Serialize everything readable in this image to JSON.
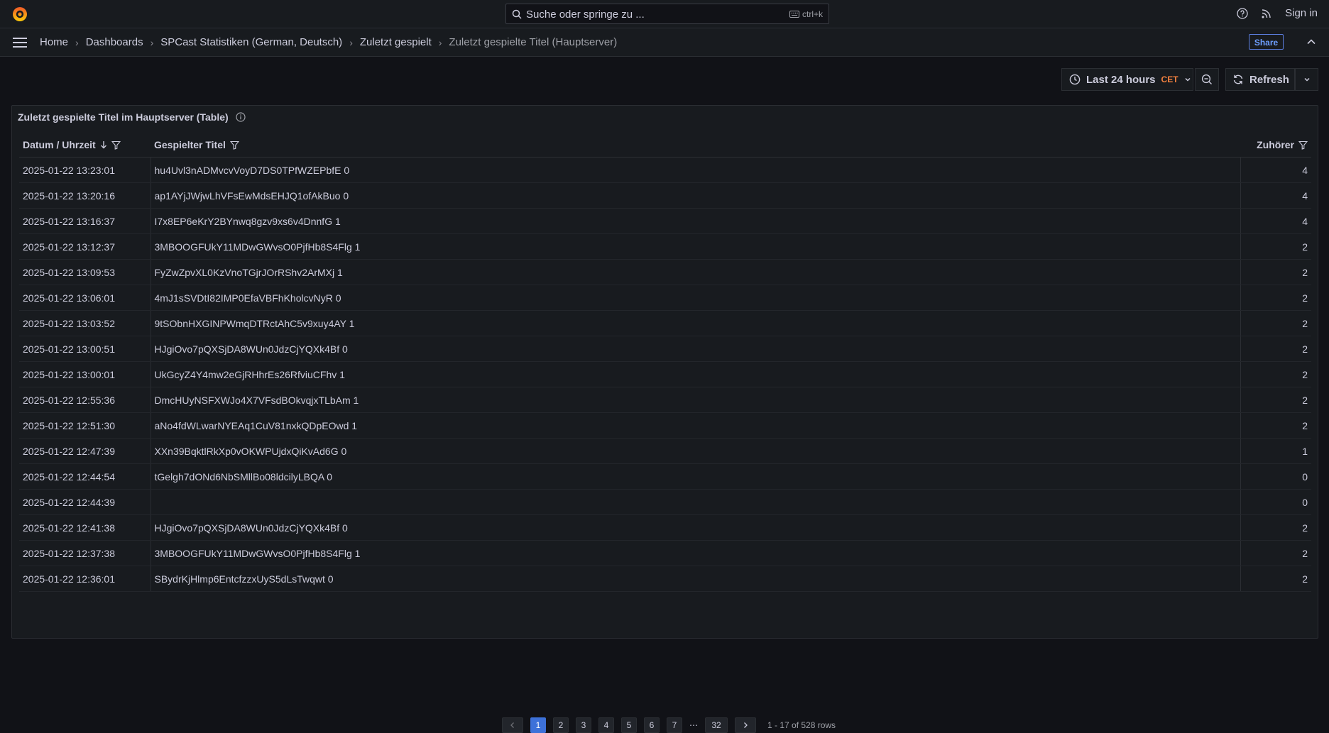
{
  "topbar": {
    "search_placeholder": "Suche oder springe zu ...",
    "shortcut": "ctrl+k",
    "sign_in": "Sign in"
  },
  "breadcrumb": {
    "items": [
      "Home",
      "Dashboards",
      "SPCast Statistiken (German, Deutsch)",
      "Zuletzt gespielt",
      "Zuletzt gespielte Titel (Hauptserver)"
    ],
    "share": "Share"
  },
  "toolbar": {
    "time_range": "Last 24 hours",
    "timezone": "CET",
    "refresh": "Refresh"
  },
  "panel": {
    "title": "Zuletzt gespielte Titel im Hauptserver (Table)",
    "columns": [
      "Datum / Uhrzeit",
      "Gespielter Titel",
      "Zuhörer"
    ],
    "rows": [
      [
        "2025-01-22 13:23:01",
        "hu4Uvl3nADMvcvVoyD7DS0TPfWZEPbfE 0",
        "4"
      ],
      [
        "2025-01-22 13:20:16",
        "ap1AYjJWjwLhVFsEwMdsEHJQ1ofAkBuo 0",
        "4"
      ],
      [
        "2025-01-22 13:16:37",
        "I7x8EP6eKrY2BYnwq8gzv9xs6v4DnnfG 1",
        "4"
      ],
      [
        "2025-01-22 13:12:37",
        "3MBOOGFUkY11MDwGWvsO0PjfHb8S4Flg 1",
        "2"
      ],
      [
        "2025-01-22 13:09:53",
        "FyZwZpvXL0KzVnoTGjrJOrRShv2ArMXj 1",
        "2"
      ],
      [
        "2025-01-22 13:06:01",
        "4mJ1sSVDtI82IMP0EfaVBFhKholcvNyR 0",
        "2"
      ],
      [
        "2025-01-22 13:03:52",
        "9tSObnHXGINPWmqDTRctAhC5v9xuy4AY 1",
        "2"
      ],
      [
        "2025-01-22 13:00:51",
        "HJgiOvo7pQXSjDA8WUn0JdzCjYQXk4Bf 0",
        "2"
      ],
      [
        "2025-01-22 13:00:01",
        "UkGcyZ4Y4mw2eGjRHhrEs26RfviuCFhv 1",
        "2"
      ],
      [
        "2025-01-22 12:55:36",
        "DmcHUyNSFXWJo4X7VFsdBOkvqjxTLbAm 1",
        "2"
      ],
      [
        "2025-01-22 12:51:30",
        "aNo4fdWLwarNYEAq1CuV81nxkQDpEOwd 1",
        "2"
      ],
      [
        "2025-01-22 12:47:39",
        "XXn39BqktlRkXp0vOKWPUjdxQiKvAd6G 0",
        "1"
      ],
      [
        "2025-01-22 12:44:54",
        "tGelgh7dONd6NbSMllBo08ldcilyLBQA 0",
        "0"
      ],
      [
        "2025-01-22 12:44:39",
        "",
        "0"
      ],
      [
        "2025-01-22 12:41:38",
        "HJgiOvo7pQXSjDA8WUn0JdzCjYQXk4Bf 0",
        "2"
      ],
      [
        "2025-01-22 12:37:38",
        "3MBOOGFUkY11MDwGWvsO0PjfHb8S4Flg 1",
        "2"
      ],
      [
        "2025-01-22 12:36:01",
        "SBydrKjHlmp6EntcfzzxUyS5dLsTwqwt 0",
        "2"
      ]
    ]
  },
  "pagination": {
    "pages": [
      "1",
      "2",
      "3",
      "4",
      "5",
      "6",
      "7"
    ],
    "ellipsis": "⋯",
    "last_page": "32",
    "current": "1",
    "info": "1 - 17 of 528 rows"
  },
  "colors": {
    "background": "#111217",
    "panel": "#181b1f",
    "accent_blue": "#3d71d9",
    "timezone_orange": "#f5813f"
  },
  "icons": [
    "grafana-logo-icon",
    "search-icon",
    "keyboard-icon",
    "help-icon",
    "rss-icon",
    "menu-icon",
    "chevron-right-icon",
    "chevron-up-icon",
    "clock-icon",
    "chevron-down-icon",
    "zoom-out-icon",
    "refresh-icon",
    "info-icon",
    "filter-icon",
    "sort-desc-icon",
    "chevron-left-icon"
  ]
}
